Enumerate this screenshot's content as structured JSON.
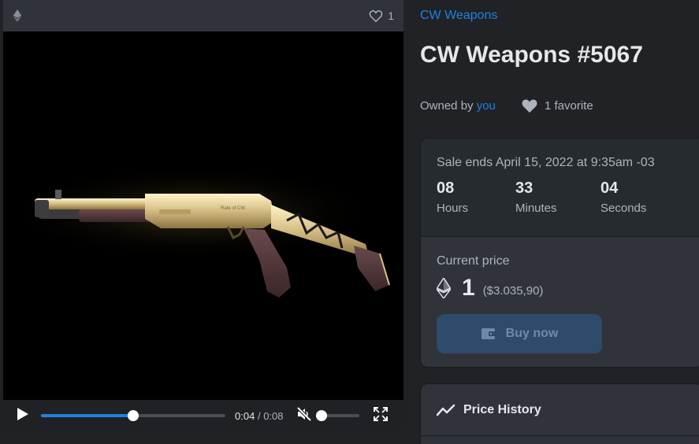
{
  "media": {
    "favorite_count": "1",
    "time_current": "0:04",
    "time_separator": "/",
    "time_duration": "0:08",
    "progress_fraction": 0.5,
    "engraving": "Rate of CW"
  },
  "icons": {
    "chain": "ethereum-icon",
    "favorite": "heart-outline-icon",
    "play": "play-icon",
    "mute": "volume-muted-icon",
    "fullscreen": "fullscreen-icon",
    "heart_filled": "heart-icon",
    "buy": "wallet-icon",
    "history": "trend-icon"
  },
  "item": {
    "collection": "CW Weapons",
    "title": "CW Weapons #5067",
    "owned_prefix": "Owned by",
    "owner": "you",
    "favorites": "1 favorite"
  },
  "sale": {
    "ends": "Sale ends April 15, 2022 at 9:35am -03",
    "countdown": [
      {
        "value": "08",
        "label": "Hours"
      },
      {
        "value": "33",
        "label": "Minutes"
      },
      {
        "value": "04",
        "label": "Seconds"
      }
    ],
    "price_label": "Current price",
    "price": "1",
    "price_usd": "($3.035,90)",
    "buy_label": "Buy now"
  },
  "history": {
    "title": "Price History"
  },
  "colors": {
    "accent": "#2081e2",
    "background": "#202225",
    "card": "#303339",
    "gold": "#d9c289"
  }
}
